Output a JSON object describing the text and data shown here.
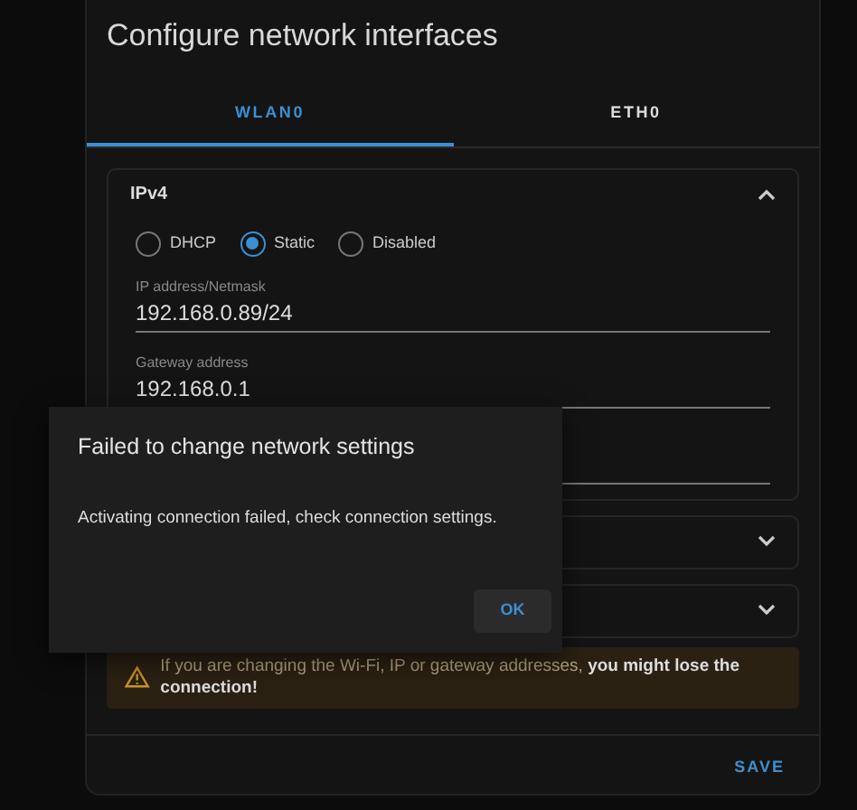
{
  "card": {
    "title": "Configure network interfaces",
    "tabs": [
      {
        "label": "WLAN0",
        "selected": true
      },
      {
        "label": "ETH0",
        "selected": false
      }
    ],
    "panels": [
      {
        "title": "IPv4",
        "expanded": true,
        "modes": [
          {
            "label": "DHCP",
            "selected": false
          },
          {
            "label": "Static",
            "selected": true
          },
          {
            "label": "Disabled",
            "selected": false
          }
        ],
        "fields": [
          {
            "kind": "text",
            "label": "IP address/Netmask",
            "value": "192.168.0.89/24"
          },
          {
            "kind": "text",
            "label": "Gateway address",
            "value": "192.168.0.1"
          },
          {
            "kind": "text"
          }
        ]
      },
      {
        "expanded": false
      },
      {
        "expanded": false
      }
    ],
    "warning": "If you are changing the Wi-Fi, IP or gateway addresses, **you might lose the connection!**",
    "save_button": "SAVE"
  },
  "dialog": {
    "title": "Failed to change network settings",
    "message": "Activating connection failed, check connection settings.",
    "button": "OK"
  }
}
